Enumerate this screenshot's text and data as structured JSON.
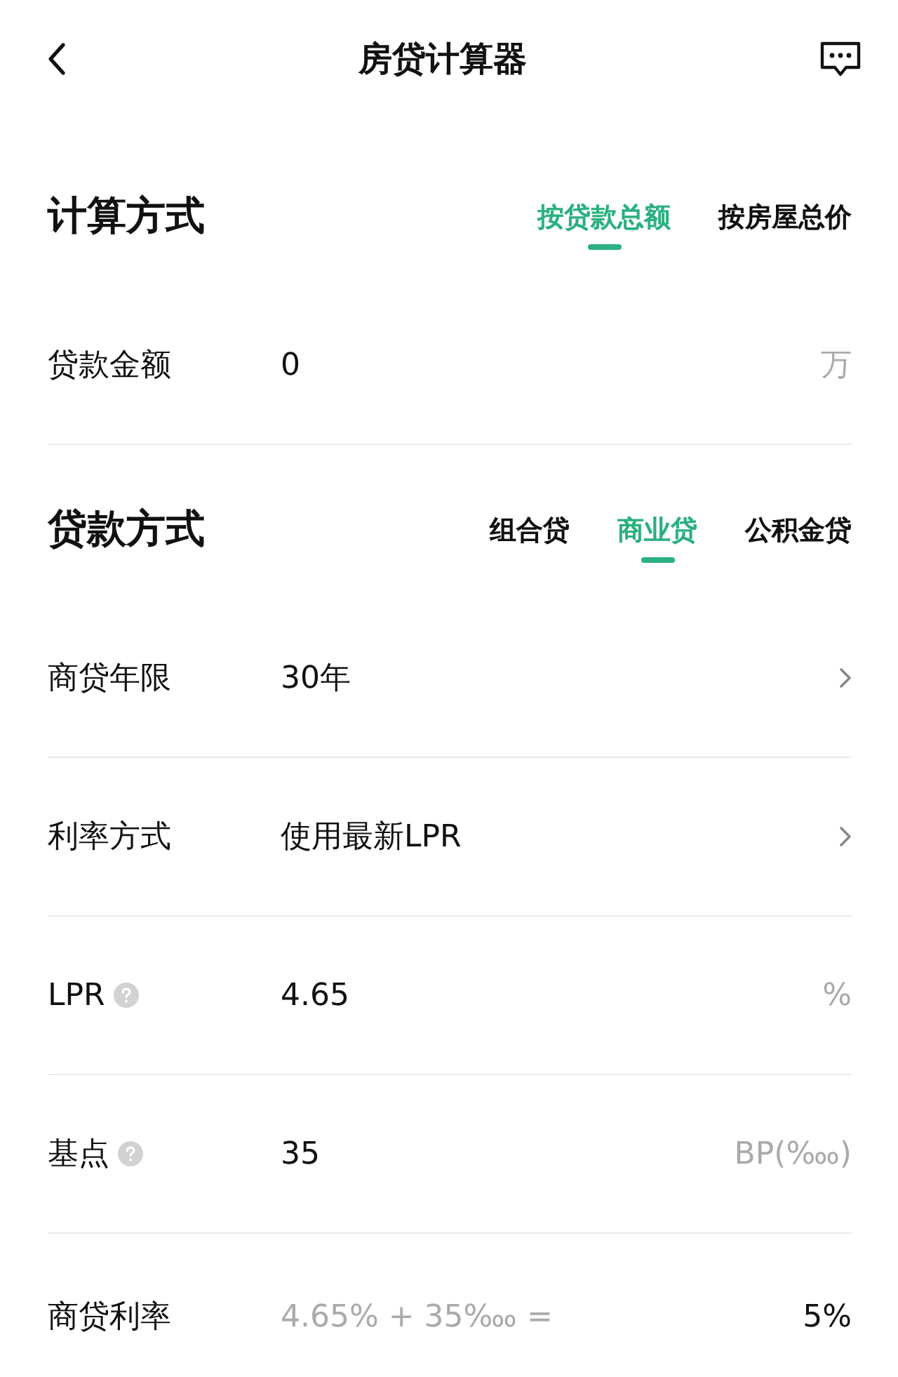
{
  "header": {
    "title": "房贷计算器"
  },
  "sections": [
    {
      "title": "计算方式",
      "tabs": [
        {
          "label": "按贷款总额",
          "selected": true
        },
        {
          "label": "按房屋总价",
          "selected": false
        }
      ],
      "rows": [
        {
          "kind": "input",
          "label": "贷款金额",
          "help": false,
          "value": "0",
          "unit": "万"
        }
      ]
    },
    {
      "title": "贷款方式",
      "tabs": [
        {
          "label": "组合贷",
          "selected": false
        },
        {
          "label": "商业贷",
          "selected": true
        },
        {
          "label": "公积金贷",
          "selected": false
        }
      ],
      "rows": [
        {
          "kind": "select",
          "label": "商贷年限",
          "help": false,
          "value": "30年"
        },
        {
          "kind": "select",
          "label": "利率方式",
          "help": false,
          "value": "使用最新LPR"
        },
        {
          "kind": "input",
          "label": "LPR",
          "help": true,
          "value": "4.65",
          "unit": "%"
        },
        {
          "kind": "input",
          "label": "基点",
          "help": true,
          "value": "35",
          "unit": "BP(‱)"
        },
        {
          "kind": "result",
          "label": "商贷利率",
          "help": false,
          "formula": "4.65% + 35‱ =",
          "value": "5%"
        }
      ]
    }
  ]
}
